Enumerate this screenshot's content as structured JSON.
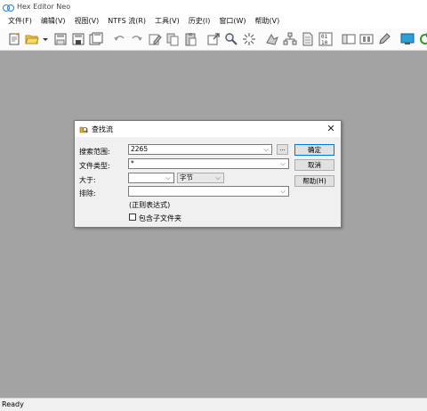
{
  "window": {
    "title": "Hex Editor Neo"
  },
  "menu": [
    "文件(F)",
    "编辑(V)",
    "视图(V)",
    "NTFS 流(R)",
    "工具(V)",
    "历史(I)",
    "窗口(W)",
    "帮助(V)"
  ],
  "toolbar_icons": [
    "new-file-icon",
    "open-folder-icon",
    "dropdown-arrow-icon",
    "save-icon",
    "save-as-icon",
    "save-all-icon",
    "undo-icon",
    "redo-icon",
    "edit-icon",
    "copy-icon",
    "paste-icon",
    "export-icon",
    "find-icon",
    "find-replace-icon",
    "bookmark-icon",
    "structure-icon",
    "file-icon",
    "binary-icon",
    "window-icon",
    "tile-icon",
    "pencil-icon",
    "monitor-icon",
    "refresh-icon"
  ],
  "dialog": {
    "title": "查找流",
    "search_scope_label": "搜索范围:",
    "search_scope_value": "2265",
    "browse_label": "...",
    "file_type_label": "文件类型:",
    "file_type_value": "*",
    "greater_than_label": "大于:",
    "greater_than_value": "",
    "size_unit_value": "字节",
    "exclude_label": "排除:",
    "exclude_value": "",
    "regex_hint": "(正则表达式)",
    "include_subfolders_label": "包含子文件夹",
    "include_subfolders_checked": false,
    "ok_label": "确定",
    "cancel_label": "取消",
    "help_label": "帮助(H)"
  },
  "status": {
    "text": "Ready"
  },
  "colors": {
    "workspace": "#a3a3a3",
    "accent": "#0078d7"
  }
}
